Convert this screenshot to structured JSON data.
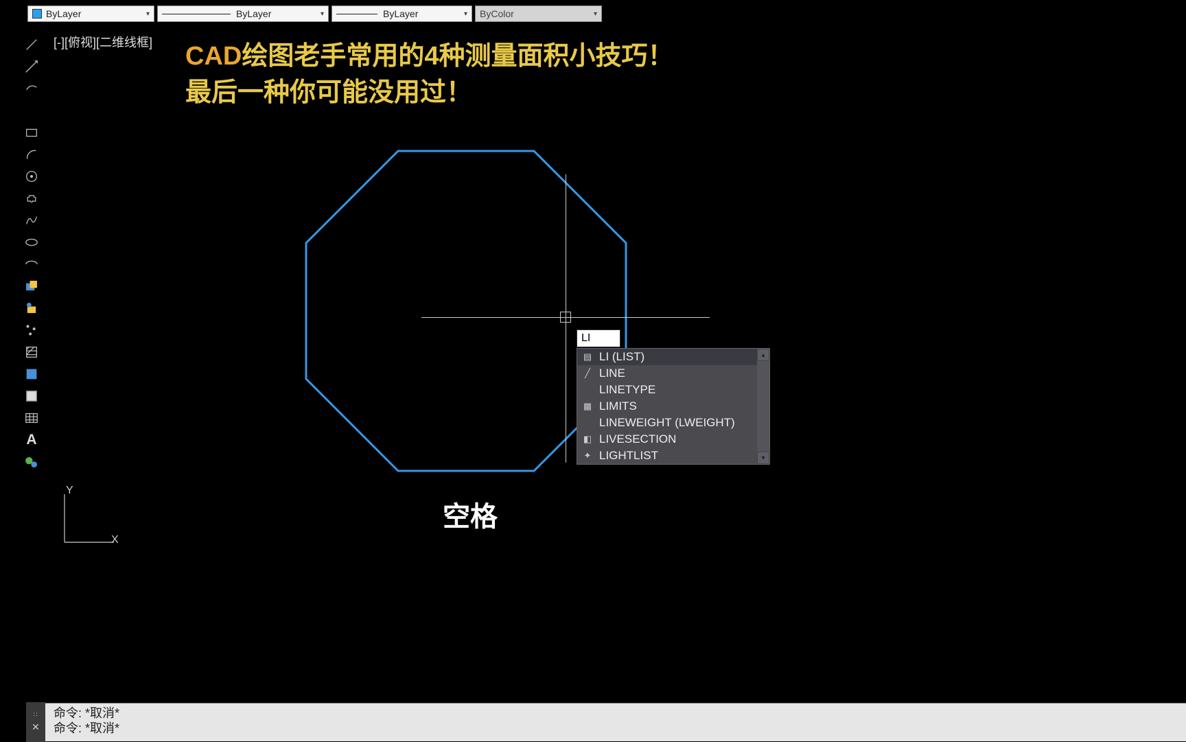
{
  "propbar": {
    "layer_color_label": "ByLayer",
    "linetype_label": "ByLayer",
    "lineweight_label": "ByLayer",
    "plotstyle_label": "ByColor"
  },
  "view_label": "[-][俯视][二维线框]",
  "title_line1_prefix": "CAD",
  "title_line1_rest": "绘图老手常用的4种测量面积小技巧！",
  "title_line2": "最后一种你可能没用过！",
  "dyn_input_value": "LI",
  "autocomplete": {
    "items": [
      {
        "label": "LI (LIST)",
        "icon": "list"
      },
      {
        "label": "LINE",
        "icon": "line"
      },
      {
        "label": "LINETYPE",
        "icon": ""
      },
      {
        "label": "LIMITS",
        "icon": "grid"
      },
      {
        "label": "LINEWEIGHT (LWEIGHT)",
        "icon": ""
      },
      {
        "label": "LIVESECTION",
        "icon": "section"
      },
      {
        "label": "LIGHTLIST",
        "icon": "light"
      }
    ]
  },
  "subtitle": "空格",
  "ucs": {
    "y_label": "Y",
    "x_label": "X"
  },
  "cmd": {
    "line1": "命令:  *取消*",
    "line2": "命令:  *取消*"
  }
}
